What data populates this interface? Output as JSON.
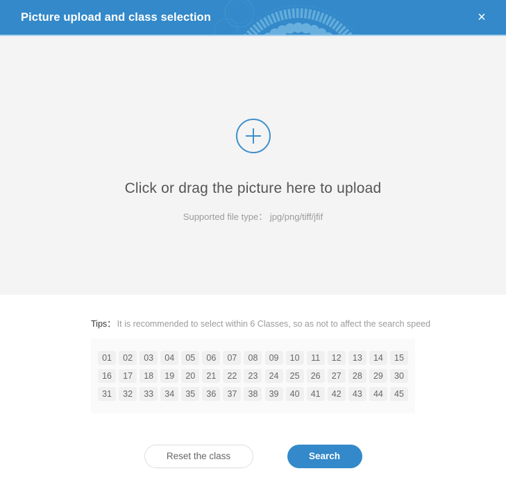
{
  "header": {
    "title": "Picture upload and class selection",
    "close_label": "×",
    "bg_color": "#3389c9",
    "underline_color": "#a9d2ee"
  },
  "upload": {
    "plus_icon": "plus-circle-icon",
    "main_text": "Click or drag the picture here to upload",
    "sub_text": "Supported file type： jpg/png/tiff/jfif",
    "bg_color": "#f4f4f4",
    "accent_color": "#3f8fcc"
  },
  "tips": {
    "label": "Tips：",
    "text": "It is recommended to select within 6 Classes, so as not to affect the search speed"
  },
  "classes": {
    "panel_bg": "#fafafa",
    "chip_bg": "#f0f0f0",
    "chip_text_color": "#666666",
    "columns": 15,
    "items": [
      "01",
      "02",
      "03",
      "04",
      "05",
      "06",
      "07",
      "08",
      "09",
      "10",
      "11",
      "12",
      "13",
      "14",
      "15",
      "16",
      "17",
      "18",
      "19",
      "20",
      "21",
      "22",
      "23",
      "24",
      "25",
      "26",
      "27",
      "28",
      "29",
      "30",
      "31",
      "32",
      "33",
      "34",
      "35",
      "36",
      "37",
      "38",
      "39",
      "40",
      "41",
      "42",
      "43",
      "44",
      "45"
    ],
    "selected": []
  },
  "actions": {
    "reset_label": "Reset the class",
    "search_label": "Search",
    "search_color": "#3389c9",
    "reset_border_color": "#dddddd"
  }
}
